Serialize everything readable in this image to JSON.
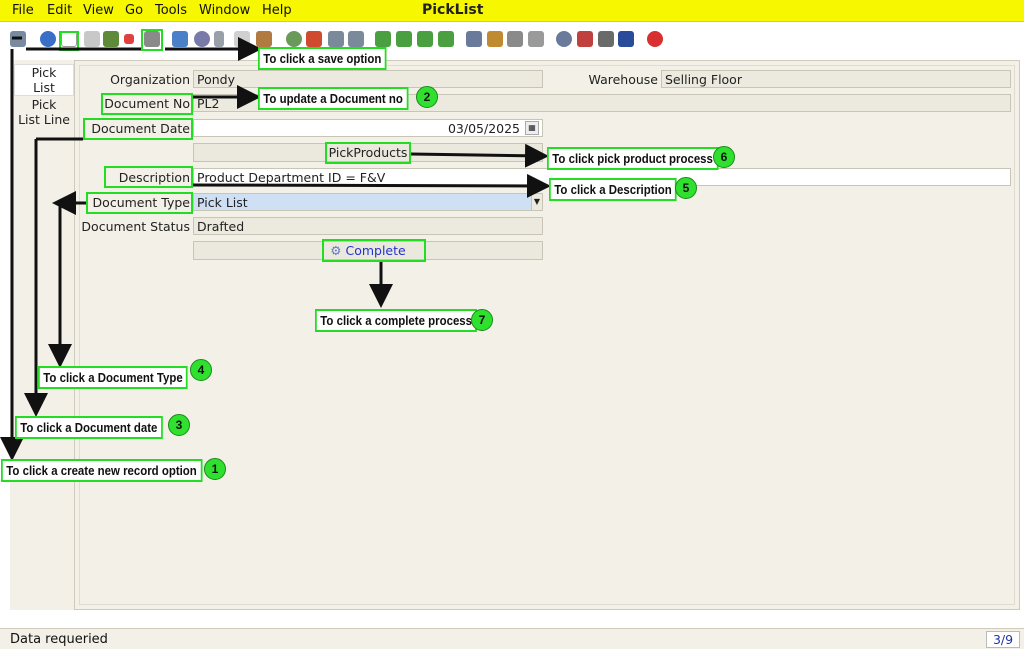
{
  "app": {
    "title": "PickList"
  },
  "menu": {
    "file": "File",
    "edit": "Edit",
    "view": "View",
    "go": "Go",
    "tools": "Tools",
    "window": "Window",
    "help": "Help"
  },
  "side_tabs": [
    {
      "label_line1": "Pick",
      "label_line2": "List"
    },
    {
      "label_line1": "Pick",
      "label_line2": "List Line"
    }
  ],
  "form": {
    "organization_label": "Organization",
    "organization_value": "Pondy",
    "warehouse_label": "Warehouse",
    "warehouse_value": "Selling Floor",
    "document_no_label": "Document No",
    "document_no_value": "PL2",
    "document_date_label": "Document Date",
    "document_date_value": "03/05/2025",
    "pickproducts_button": "PickProducts",
    "description_label": "Description",
    "description_value": "Product Department ID = F&V",
    "document_type_label": "Document Type",
    "document_type_value": "Pick List",
    "document_status_label": "Document Status",
    "document_status_value": "Drafted",
    "complete_button": "Complete"
  },
  "annotations": {
    "save": "To click a save option",
    "document_no": "To update a Document no",
    "pick_product": "To click pick product process",
    "description": "To click a Description",
    "complete": "To click a complete process",
    "document_type": "To click a Document Type",
    "document_date": "To click a Document date",
    "new_record": "To click a create new record option",
    "badge_1": "1",
    "badge_2": "2",
    "badge_3": "3",
    "badge_4": "4",
    "badge_5": "5",
    "badge_6": "6",
    "badge_7": "7"
  },
  "status": {
    "text": "Data requeried",
    "count": "3/9"
  },
  "colors": {
    "menubar": "#f7f700",
    "highlight": "#22dd22",
    "badge": "#2fe02f"
  }
}
